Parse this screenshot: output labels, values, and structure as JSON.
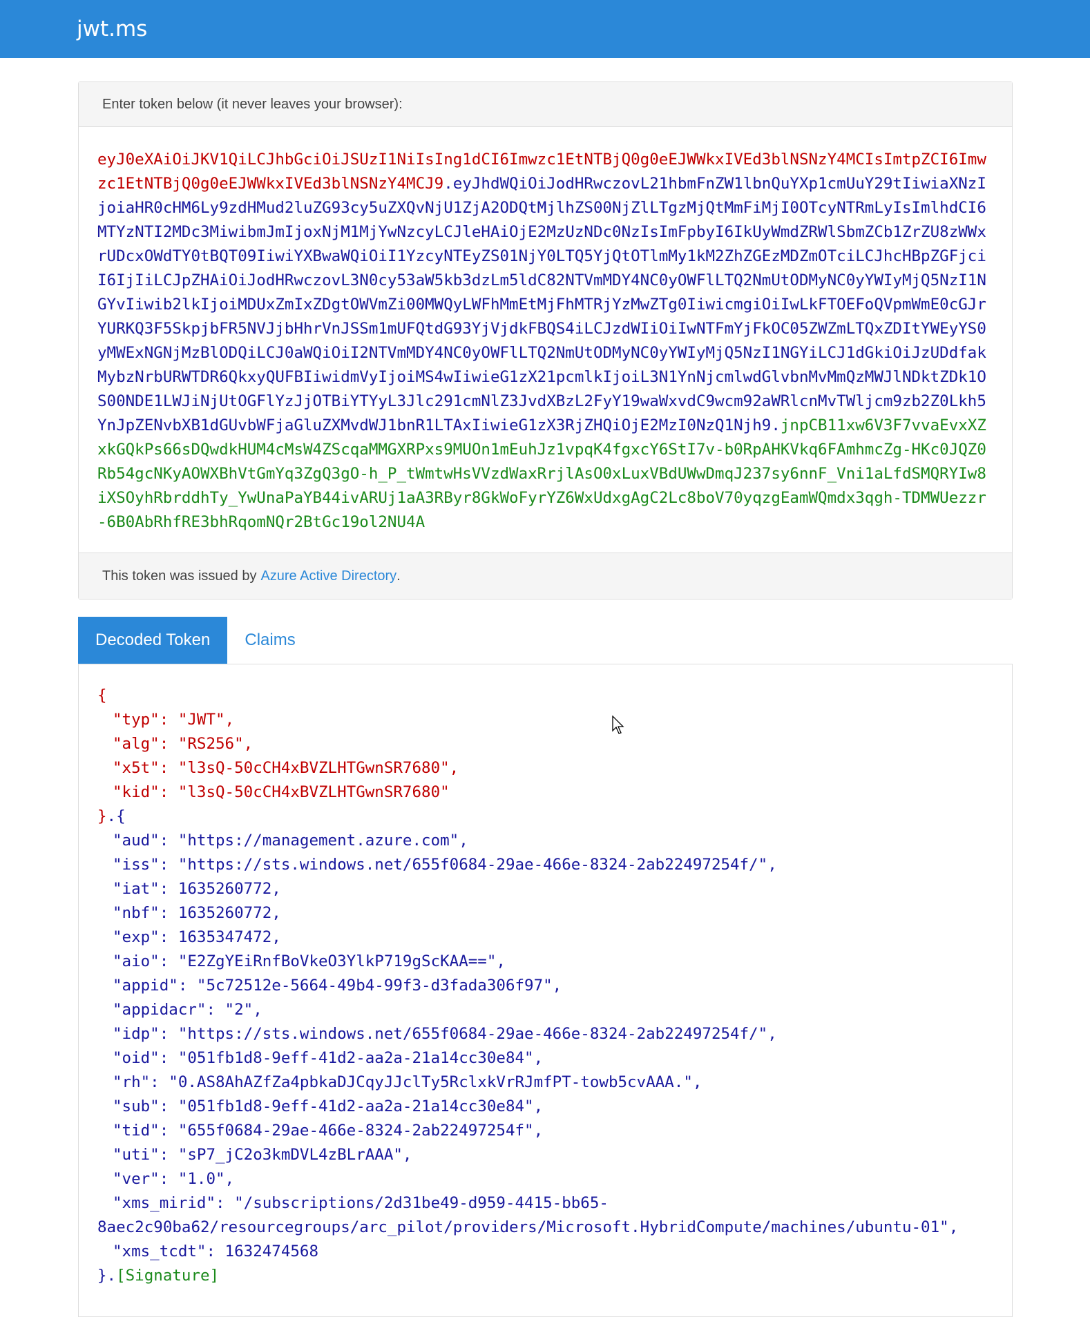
{
  "brand": "jwt.ms",
  "token_panel": {
    "heading": "Enter token below (it never leaves your browser):",
    "header_part": "eyJ0eXAiOiJKV1QiLCJhbGciOiJSUzI1NiIsIng1dCI6Imwzc1EtNTBjQ0g0eEJWWkxIVEd3blNSNzY4MCIsImtpZCI6Imwzc1EtNTBjQ0g0eEJWWkxIVEd3blNSNzY4MCJ9",
    "payload_part": "eyJhdWQiOiJodHRwczovL21hbmFnZW1lbnQuYXp1cmUuY29tIiwiaXNzIjoiaHR0cHM6Ly9zdHMud2luZG93cy5uZXQvNjU1ZjA2ODQtMjlhZS00NjZlLTgzMjQtMmFiMjI0OTcyNTRmLyIsImlhdCI6MTYzNTI2MDc3MiwibmJmIjoxNjM1MjYwNzcyLCJleHAiOjE2MzUzNDc0NzIsImFpbyI6IkUyWmdZRWlSbmZCb1ZrZU8zWWxrUDcxOWdTY0tBQT09IiwiYXBwaWQiOiI1YzcyNTEyZS01NjY0LTQ5YjQtOTlmMy1kM2ZhZGEzMDZmOTciLCJhcHBpZGFjciI6IjIiLCJpZHAiOiJodHRwczovL3N0cy53aW5kb3dzLm5ldC82NTVmMDY4NC0yOWFlLTQ2NmUtODMyNC0yYWIyMjQ5NzI1NGYvIiwib2lkIjoiMDUxZmIxZDgtOWVmZi00MWQyLWFhMmEtMjFhMTRjYzMwZTg0IiwicmgiOiIwLkFTOEFoQVpmWmE0cGJrYURKQ3F5SkpjbFR5NVJjbHhrVnJSSm1mUFQtdG93YjVjdkFBQS4iLCJzdWIiOiIwNTFmYjFkOC05ZWZmLTQxZDItYWEyYS0yMWExNGNjMzBlODQiLCJ0aWQiOiI2NTVmMDY4NC0yOWFlLTQ2NmUtODMyNC0yYWIyMjQ5NzI1NGYiLCJ1dGkiOiJzUDdfakMybzNrbURWTDR6QkxyQUFBIiwidmVyIjoiMS4wIiwieG1zX21pcmlkIjoiL3N1YnNjcmlwdGlvbnMvMmQzMWJlNDktZDk1OS00NDE1LWJiNjUtOGFlYzJjOTBiYTYyL3Jlc291cmNlZ3JvdXBzL2FyY19waWxvdC9wcm92aWRlcnMvTWljcm9zb2Z0Lkh5YnJpZENvbXB1dGUvbWFjaGluZXMvdWJ1bnR1LTAxIiwieG1zX3RjZHQiOjE2MzI0NzQ1Njh9",
    "signature_part": "jnpCB11xw6V3F7vvaEvxXZxkGQkPs66sDQwdkHUM4cMsW4ZScqaMMGXRPxs9MUOn1mEuhJz1vpqK4fgxcY6StI7v-b0RpAHKVkq6FAmhmcZg-HKc0JQZ0Rb54gcNKyAOWXBhVtGmYq3ZgQ3gO-h_P_tWmtwHsVVzdWaxRrjlAsO0xLuxVBdUWwDmqJ237sy6nnF_Vni1aLfdSMQRYIw8iXSOyhRbrddhTy_YwUnaPaYB44ivARUj1aA3RByr8GkWoFyrYZ6WxUdxgAgC2Lc8boV70yqzgEamWQmdx3qgh-TDMWUezzr-6B0AbRhfRE3bhRqomNQr2BtGc19ol2NU4A",
    "footer_prefix": "This token was issued by",
    "footer_link": "Azure Active Directory",
    "footer_suffix": "."
  },
  "tabs": [
    {
      "label": "Decoded Token",
      "active": true
    },
    {
      "label": "Claims",
      "active": false
    }
  ],
  "decoded": {
    "header_lines": [
      "\"typ\": \"JWT\",",
      "\"alg\": \"RS256\",",
      "\"x5t\": \"l3sQ-50cCH4xBVZLHTGwnSR7680\",",
      "\"kid\": \"l3sQ-50cCH4xBVZLHTGwnSR7680\""
    ],
    "payload_lines": [
      "\"aud\": \"https://management.azure.com\",",
      "\"iss\": \"https://sts.windows.net/655f0684-29ae-466e-8324-2ab22497254f/\",",
      "\"iat\": 1635260772,",
      "\"nbf\": 1635260772,",
      "\"exp\": 1635347472,",
      "\"aio\": \"E2ZgYEiRnfBoVkeO3YlkP719gScKAA==\",",
      "\"appid\": \"5c72512e-5664-49b4-99f3-d3fada306f97\",",
      "\"appidacr\": \"2\",",
      "\"idp\": \"https://sts.windows.net/655f0684-29ae-466e-8324-2ab22497254f/\",",
      "\"oid\": \"051fb1d8-9eff-41d2-aa2a-21a14cc30e84\",",
      "\"rh\": \"0.AS8AhAZfZa4pbkaDJCqyJJclTy5RclxkVrRJmfPT-towb5cvAAA.\",",
      "\"sub\": \"051fb1d8-9eff-41d2-aa2a-21a14cc30e84\",",
      "\"tid\": \"655f0684-29ae-466e-8324-2ab22497254f\",",
      "\"uti\": \"sP7_jC2o3kmDVL4zBLrAAA\",",
      "\"ver\": \"1.0\",",
      "\"xms_mirid\": \"/subscriptions/2d31be49-d959-4415-bb65-",
      "8aec2c90ba62/resourcegroups/arc_pilot/providers/Microsoft.HybridCompute/machines/ubuntu-01\",",
      "\"xms_tcdt\": 1632474568"
    ],
    "open_brace": "{",
    "header_close": "}",
    "dot": ".",
    "payload_open": "{",
    "payload_close": "}",
    "signature_label": "[Signature]"
  }
}
